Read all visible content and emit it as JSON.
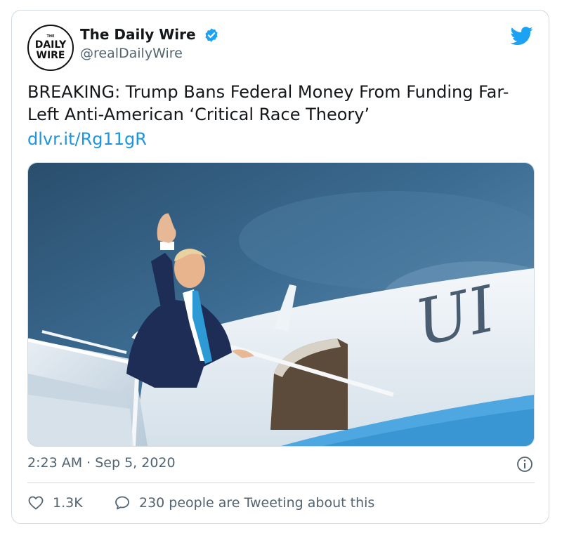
{
  "tweet": {
    "author": {
      "name": "The Daily Wire",
      "handle": "@realDailyWire",
      "verified": true,
      "avatar_text": {
        "small": "THE",
        "line1": "DAILY",
        "line2": "WIRE"
      }
    },
    "text": "BREAKING: Trump Bans Federal Money From Funding Far-Left Anti-American ‘Critical Race Theory’",
    "link": "dlvr.it/Rg11gR",
    "media": {
      "plane_lettering": "UI"
    },
    "timestamp": "2:23 AM · Sep 5, 2020",
    "actions": {
      "like_count": "1.3K",
      "tweeting_label": "230 people are Tweeting about this"
    }
  },
  "colors": {
    "accent": "#1b95e0",
    "twitter_blue": "#1da1f2",
    "secondary_text": "#536471",
    "border": "#cfd9de"
  },
  "icons": {
    "brand": "twitter-bird-icon",
    "verified": "verified-badge-icon",
    "info": "info-icon",
    "like": "heart-icon",
    "reply": "speech-bubble-icon"
  }
}
